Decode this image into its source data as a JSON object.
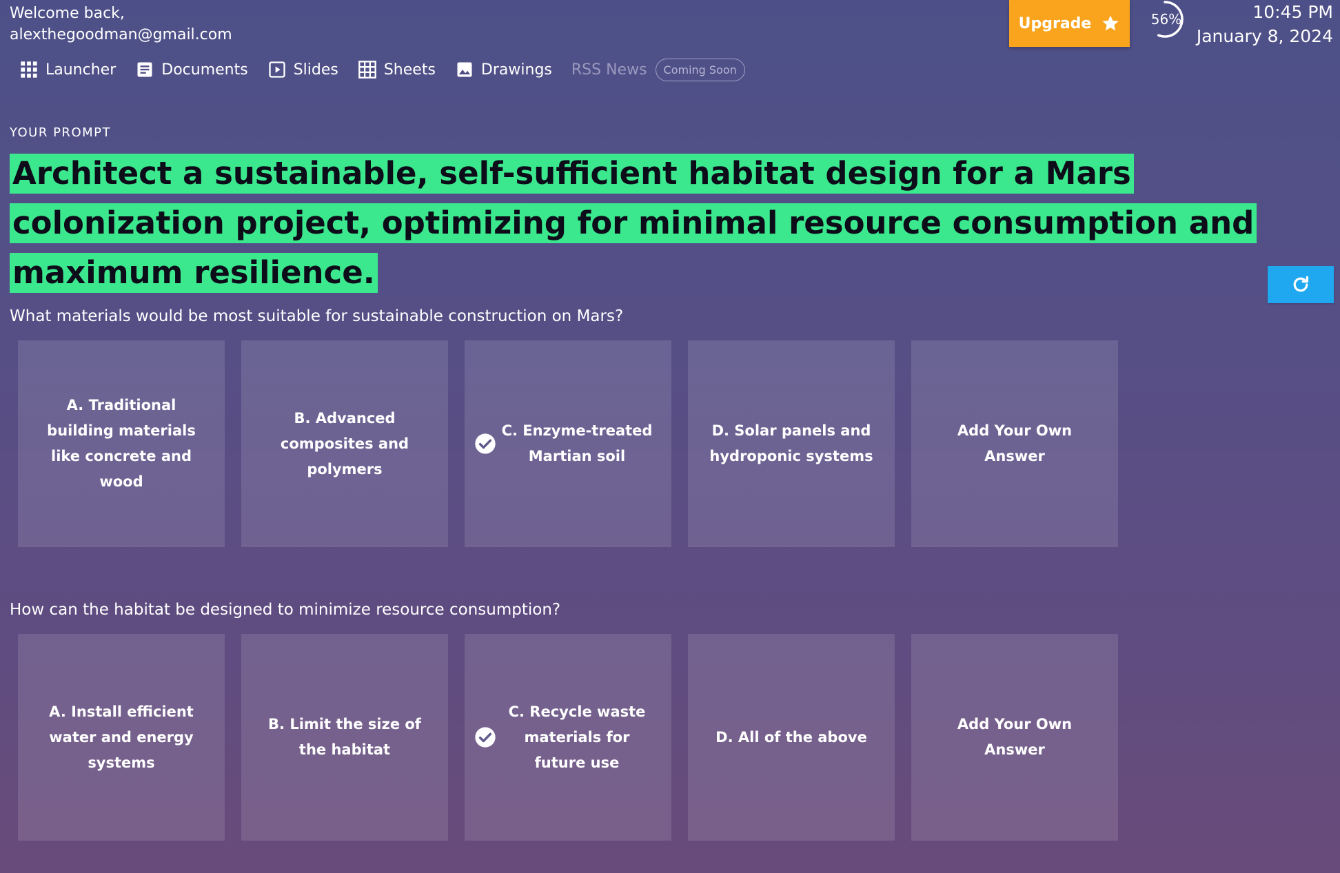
{
  "header": {
    "welcome_line": "Welcome back,",
    "email": "alexthegoodman@gmail.com",
    "upgrade_label": "Upgrade",
    "progress_label": "56%",
    "progress_value": 0.56,
    "time": "10:45 PM",
    "date": "January 8, 2024"
  },
  "nav": {
    "launcher": "Launcher",
    "documents": "Documents",
    "slides": "Slides",
    "sheets": "Sheets",
    "drawings": "Drawings",
    "rss": "RSS News",
    "rss_badge": "Coming Soon"
  },
  "prompt": {
    "label": "YOUR PROMPT",
    "text": "Architect a sustainable, self-sufficient habitat design for a Mars colonization project, optimizing for minimal resource consumption and maximum resilience."
  },
  "questions": [
    {
      "text": "What materials would be most suitable for sustainable construction on Mars?",
      "options": [
        {
          "label": "A. Traditional building materials like concrete and wood",
          "selected": false
        },
        {
          "label": "B. Advanced composites and polymers",
          "selected": false
        },
        {
          "label": "C. Enzyme-treated Martian soil",
          "selected": true
        },
        {
          "label": "D. Solar panels and hydroponic systems",
          "selected": false
        },
        {
          "label": "Add Your Own Answer",
          "selected": false
        }
      ]
    },
    {
      "text": "How can the habitat be designed to minimize resource consumption?",
      "options": [
        {
          "label": "A. Install efficient water and energy systems",
          "selected": false
        },
        {
          "label": "B. Limit the size of the habitat",
          "selected": false
        },
        {
          "label": "C. Recycle waste materials for future use",
          "selected": true
        },
        {
          "label": "D. All of the above",
          "selected": false
        },
        {
          "label": "Add Your Own Answer",
          "selected": false
        }
      ]
    }
  ],
  "colors": {
    "accent_orange": "#f9a41c",
    "prompt_highlight": "#3be88e",
    "refresh_blue": "#1fa8ef"
  }
}
